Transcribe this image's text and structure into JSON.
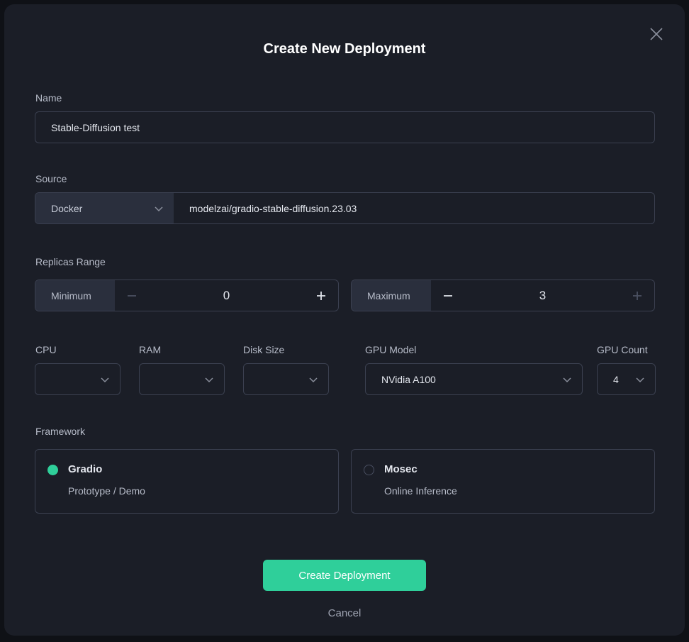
{
  "dialog": {
    "title": "Create New Deployment",
    "cancel_label": "Cancel",
    "submit_label": "Create Deployment"
  },
  "name": {
    "label": "Name",
    "value": "Stable-Diffusion test"
  },
  "source": {
    "label": "Source",
    "type": "Docker",
    "image": "modelzai/gradio-stable-diffusion.23.03"
  },
  "replicas": {
    "label": "Replicas Range",
    "min_label": "Minimum",
    "min_value": "0",
    "max_label": "Maximum",
    "max_value": "3"
  },
  "resources": {
    "cpu_label": "CPU",
    "cpu_value": "",
    "ram_label": "RAM",
    "ram_value": "",
    "disk_label": "Disk Size",
    "disk_value": "",
    "gpu_model_label": "GPU Model",
    "gpu_model_value": "NVidia A100",
    "gpu_count_label": "GPU Count",
    "gpu_count_value": "4"
  },
  "framework": {
    "label": "Framework",
    "options": [
      {
        "name": "Gradio",
        "description": "Prototype / Demo",
        "selected": true
      },
      {
        "name": "Mosec",
        "description": "Online Inference",
        "selected": false
      }
    ]
  },
  "colors": {
    "accent": "#2fcf9a",
    "background": "#1b1e27",
    "border": "#3b4050"
  },
  "icons": {
    "close": "close-icon",
    "chevron": "chevron-down-icon",
    "minus": "minus-icon",
    "plus": "plus-icon"
  }
}
